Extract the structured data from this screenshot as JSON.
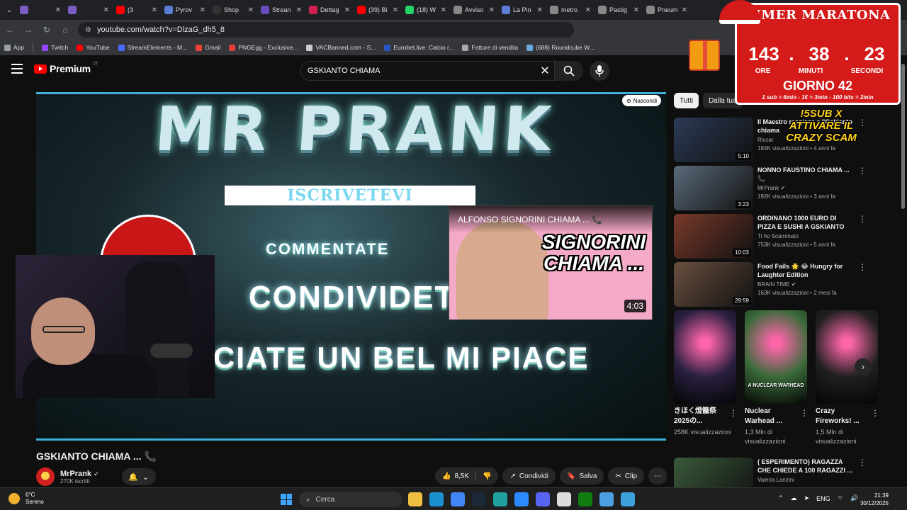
{
  "browser": {
    "tabs": [
      {
        "label": "",
        "color": "#7b5cc7"
      },
      {
        "label": "",
        "color": "#7b5cc7"
      },
      {
        "label": "(3",
        "color": "#ff0000"
      },
      {
        "label": "Pyrov",
        "color": "#5a7dd8"
      },
      {
        "label": "Shop",
        "color": "#333333"
      },
      {
        "label": "Strean",
        "color": "#6a4cc0"
      },
      {
        "label": "Dettag",
        "color": "#d02050"
      },
      {
        "label": "(39) Bi",
        "color": "#ff0000"
      },
      {
        "label": "(18) W",
        "color": "#25d366"
      },
      {
        "label": "Avviso",
        "color": "#888888"
      },
      {
        "label": "La Pin",
        "color": "#5a7dd8"
      },
      {
        "label": "metro",
        "color": "#888888"
      },
      {
        "label": "Pastig",
        "color": "#888888"
      },
      {
        "label": "Pneum",
        "color": "#888888"
      }
    ],
    "url": "youtube.com/watch?v=DlzaG_dh5_8",
    "bookmarks": [
      {
        "label": "App",
        "color": "#9aa0a6"
      },
      {
        "label": "Twitch",
        "color": "#9146ff"
      },
      {
        "label": "YouTube",
        "color": "#ff0000"
      },
      {
        "label": "StreamElements - M...",
        "color": "#4f6bff"
      },
      {
        "label": "Gmail",
        "color": "#ea4335"
      },
      {
        "label": "PNGEgg - Exclusive...",
        "color": "#e03c3c"
      },
      {
        "label": "VACBanned.com - S...",
        "color": "#cccccc"
      },
      {
        "label": "Eurobet.live: Calcio r...",
        "color": "#2a55c5"
      },
      {
        "label": "Fatture di vendita",
        "color": "#aaaaaa"
      },
      {
        "label": "(688) Roundcube W...",
        "color": "#66aadd"
      }
    ]
  },
  "youtube": {
    "logo_text": "Premium",
    "logo_country": "IT",
    "search_value": "GSKIANTO CHIAMA",
    "player": {
      "headline": "MR PRANK",
      "banner": "ISCRIVETEVI",
      "line1": "COMMENTATE",
      "line2": "CONDIVIDET",
      "line3": "CIATE UN BEL MI PIACE",
      "hide_label": "Nascondi"
    },
    "miniplayer": {
      "title": "ALFONSO SIGNORINI CHIAMA ... 📞",
      "big_text": "SIGNORINI CHIAMA ...",
      "duration": "4:03"
    },
    "video_title": "GSKIANTO CHIAMA ... 📞",
    "channel": {
      "name": "MrPrank",
      "subs": "270K iscritti"
    },
    "actions": {
      "likes": "8,5K",
      "share": "Condividi",
      "save": "Salva",
      "clip": "Clip"
    },
    "chips": [
      "Tutti",
      "Dalla tua"
    ],
    "recommendations": [
      {
        "title": "Il Maestro reagisce a \"Gskianto chiama",
        "channel": "Riccar",
        "meta": "184K visualizzazioni • 4 anni fa",
        "duration": "5:10",
        "color": "#2b3a55"
      },
      {
        "title": "NONNO FAUSTINO CHIAMA ... 📞",
        "channel": "MrPrank ✔",
        "meta": "192K visualizzazioni • 3 anni fa",
        "duration": "3:23",
        "color": "#5a6a7a"
      },
      {
        "title": "ORDINANO 1000 EURO DI PIZZA E SUSHI A GSKIANTO E...",
        "channel": "Ti ho Scammato",
        "meta": "753K visualizzazioni • 5 anni fa",
        "duration": "10:03",
        "color": "#7a3a2a"
      },
      {
        "title": "Food Fails 🌟 😂 Hungry for Laughter Edition",
        "channel": "BRAIN TIME ✔",
        "meta": "163K visualizzazioni • 2 mesi fa",
        "duration": "29:59",
        "color": "#6a5040"
      },
      {
        "title": "( ESPERIMENTO) RAGAZZA CHE CHIEDE A 100 RAGAZZI ...",
        "channel": "Valeria Lanzini",
        "meta": "",
        "duration": "",
        "color": "#3a5a3a"
      }
    ],
    "shorts": [
      {
        "title": "きほく燈籠祭2025の...",
        "views": "258K visualizzazioni",
        "color": "#2a2040",
        "tag": ""
      },
      {
        "title": "Nuclear Warhead ...",
        "views": "1,3 Mln di visualizzazioni",
        "color": "#3a6a3a",
        "tag": "A NUCLEAR WARHEAD"
      },
      {
        "title": "Crazy Fireworks! ...",
        "views": "1,5 Mln di visualizzazioni",
        "color": "#202020",
        "tag": ""
      }
    ]
  },
  "overlay": {
    "timer_title": "TIMER MARATONA",
    "hours": "143",
    "minutes": "38",
    "seconds": "23",
    "label_hours": "ORE",
    "label_minutes": "MINUTI",
    "label_seconds": "SECONDI",
    "day": "GIORNO 42",
    "rates": "1 sub = 6min - 1€ = 3min - 100 bits = 2min",
    "scam_text": "!5SUB X ATTIVARE IL CRAZY SCAM"
  },
  "taskbar": {
    "temp": "6°C",
    "weather": "Sereno",
    "search_placeholder": "Cerca",
    "lang": "ENG",
    "time": "21:39",
    "date": "30/12/2025",
    "apps": [
      "#f0c040",
      "#1a8fd0",
      "#4285f4",
      "#1b2838",
      "#20a0a0",
      "#2a8aff",
      "#5865f2",
      "#dddddd",
      "#107c10",
      "#4aa0e0",
      "#3da0d8"
    ]
  }
}
